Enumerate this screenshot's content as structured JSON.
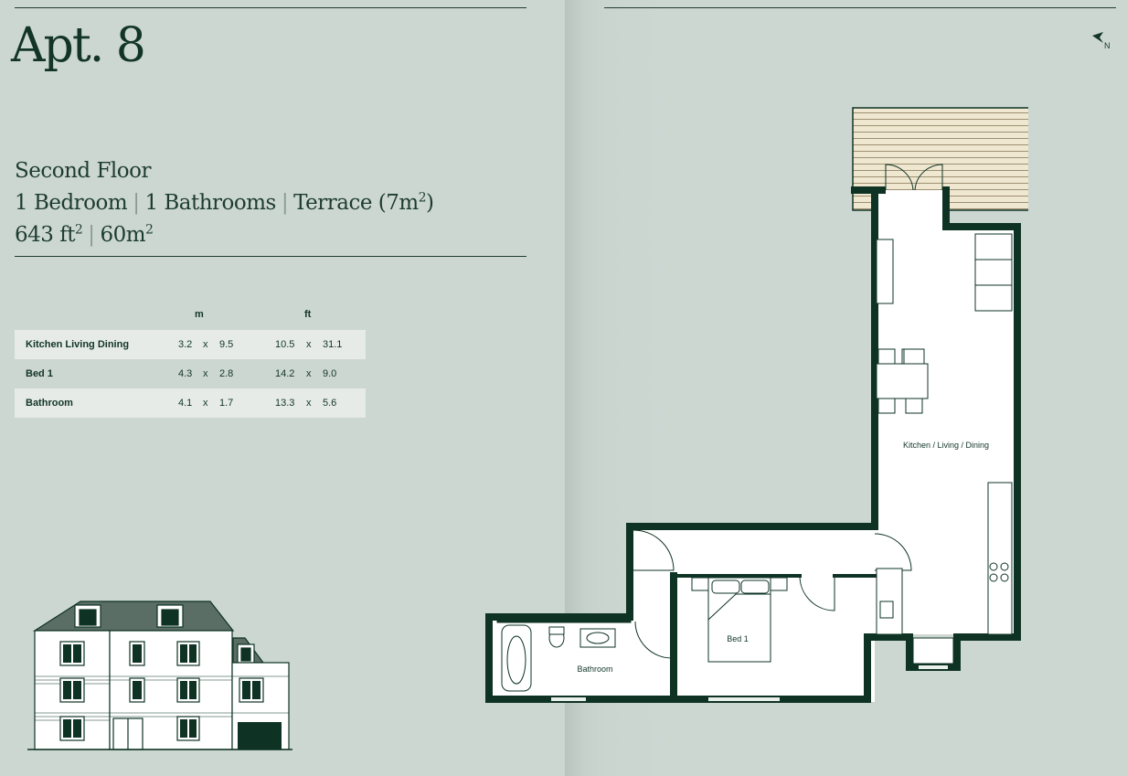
{
  "apartment": {
    "title": "Apt. 8",
    "floor": "Second Floor",
    "bedrooms": "1 Bedroom",
    "bathrooms": "1 Bathrooms",
    "terrace": "Terrace (7m",
    "terrace_sup": "2",
    "terrace_close": ")",
    "area_ft_value": "643 ft",
    "area_ft_sup": "2",
    "area_m_value": "60m",
    "area_m_sup": "2"
  },
  "table": {
    "col_m": "m",
    "col_ft": "ft",
    "rows": [
      {
        "name": "Kitchen Living Dining",
        "m1": "3.2",
        "mx": "x",
        "m2": "9.5",
        "ft1": "10.5",
        "ftx": "x",
        "ft2": "31.1"
      },
      {
        "name": "Bed 1",
        "m1": "4.3",
        "mx": "x",
        "m2": "2.8",
        "ft1": "14.2",
        "ftx": "x",
        "ft2": "9.0"
      },
      {
        "name": "Bathroom",
        "m1": "4.1",
        "mx": "x",
        "m2": "1.7",
        "ft1": "13.3",
        "ftx": "x",
        "ft2": "5.6"
      }
    ]
  },
  "compass": {
    "label": "N",
    "icon": "north-arrow-icon"
  },
  "floorplan": {
    "rooms": {
      "kitchen": "Kitchen / Living / Dining",
      "bed": "Bed 1",
      "bath": "Bathroom"
    }
  },
  "colors": {
    "background": "#cdd7d2",
    "ink": "#123528",
    "wall": "#0e3324",
    "terrace": "#efe7d0",
    "table_shade": "#e6ebe8"
  }
}
